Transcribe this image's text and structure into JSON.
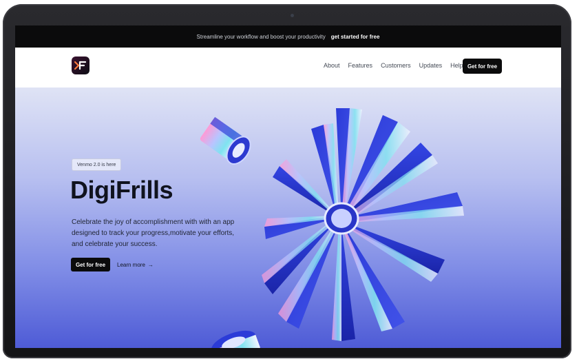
{
  "announcement": {
    "text": "Streamline your workflow and boost your productivity",
    "link": "get started for free"
  },
  "nav": {
    "logo_letter": "F",
    "links": [
      "About",
      "Features",
      "Customers",
      "Updates",
      "Help"
    ],
    "cta": "Get for free"
  },
  "hero": {
    "badge": "Venmo 2.0 is here",
    "title": "DigiFrills",
    "description": "Celebrate the joy of accomplishment with with an app designed to track your progress,motivate your efforts, and celebrate your success.",
    "cta": "Get for free",
    "learn_more": "Learn more",
    "learn_more_arrow": "→"
  },
  "colors": {
    "accent": "#0b0b0c",
    "hero_gradient_top": "#dfe3f5",
    "hero_gradient_bottom": "#4e5bd6"
  },
  "icons": {
    "logo": "brand-logo-icon",
    "arrow": "arrow-right-icon"
  }
}
